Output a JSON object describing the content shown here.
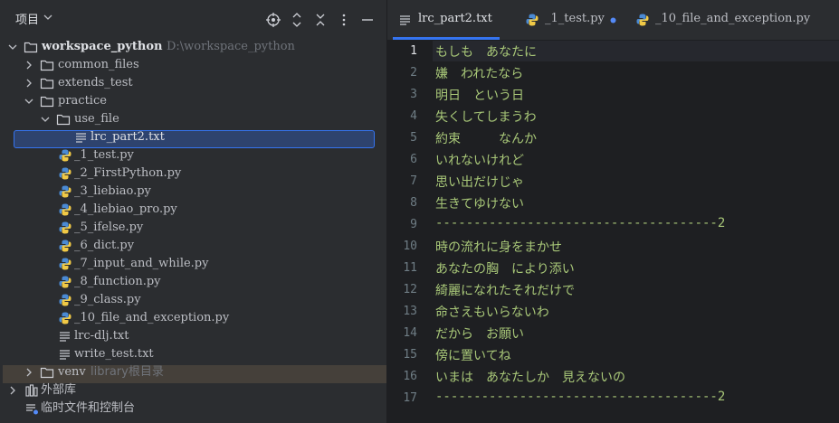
{
  "panel": {
    "title": "项目",
    "header_icons": [
      "locate-icon",
      "expand-all-icon",
      "collapse-all-icon",
      "more-options-icon",
      "minimize-icon"
    ]
  },
  "tree": {
    "root": {
      "label": "workspace_python",
      "path": "D:\\workspace_python"
    },
    "common_files": "common_files",
    "extends_test": "extends_test",
    "practice": "practice",
    "use_file": "use_file",
    "selected_file": "lrc_part2.txt",
    "files": [
      "_1_test.py",
      "_2_FirstPython.py",
      "_3_liebiao.py",
      "_4_liebiao_pro.py",
      "_5_ifelse.py",
      "_6_dict.py",
      "_7_input_and_while.py",
      "_8_function.py",
      "_9_class.py",
      "_10_file_and_exception.py"
    ],
    "text_files": [
      "lrc-dlj.txt",
      "write_test.txt"
    ],
    "venv": {
      "label": "venv",
      "hint": "library根目录"
    },
    "external_libs": "外部库",
    "scratches": "临时文件和控制台"
  },
  "tabs": [
    {
      "label": "lrc_part2.txt",
      "icon": "text-file-icon",
      "active": true
    },
    {
      "label": "_1_test.py",
      "icon": "python-icon",
      "modified": true
    },
    {
      "label": "_10_file_and_exception.py",
      "icon": "python-icon"
    }
  ],
  "editor": {
    "current_line": 1,
    "line_numbers": [
      "1",
      "2",
      "3",
      "4",
      "5",
      "6",
      "7",
      "8",
      "9",
      "10",
      "11",
      "12",
      "13",
      "14",
      "15",
      "16",
      "17"
    ],
    "lines": [
      "もしも　あなたに",
      "嫌　われたなら",
      "明日　という日",
      "失くしてしまうわ",
      "約束　　　なんか",
      "いれないけれど",
      "思い出だけじゃ",
      "生きてゆけない",
      "-------------------------------------2",
      "時の流れに身をまかせ",
      "あなたの胸　により添い",
      "綺麗になれたそれだけで",
      "命さえもいらないわ",
      "だから　お願い",
      "傍に置いてね",
      "いまは　あなたしか　見えないの",
      "-------------------------------------2"
    ]
  },
  "colors": {
    "accent": "#3574f0",
    "code_text": "#a8c778",
    "python_blue": "#4a8ad4",
    "python_yellow": "#f0c946"
  }
}
